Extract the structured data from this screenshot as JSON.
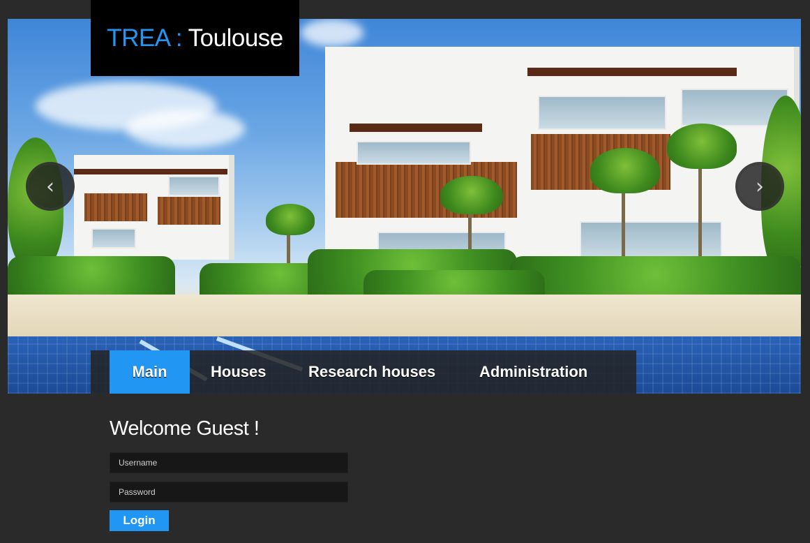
{
  "logo": {
    "brand": "TREA",
    "separator": " : ",
    "city": "Toulouse"
  },
  "slider": {
    "prev_icon": "chevron-left-icon",
    "next_icon": "chevron-right-icon",
    "prev_glyph": "‹",
    "next_glyph": "›"
  },
  "nav": {
    "items": [
      {
        "label": "Main",
        "active": true
      },
      {
        "label": "Houses",
        "active": false
      },
      {
        "label": "Research houses",
        "active": false
      },
      {
        "label": "Administration",
        "active": false
      }
    ]
  },
  "login": {
    "welcome": "Welcome Guest !",
    "username_placeholder": "Username",
    "password_placeholder": "Password",
    "button_label": "Login"
  },
  "colors": {
    "accent": "#2196f3",
    "background": "#2a2a2a",
    "input_bg": "#171717"
  }
}
